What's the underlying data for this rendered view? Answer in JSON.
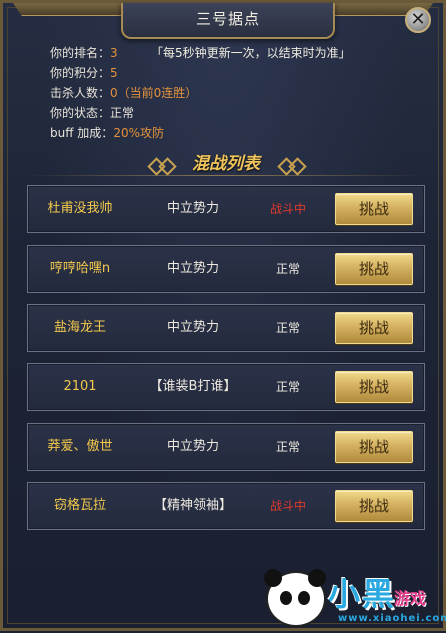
{
  "window": {
    "title": "三号据点",
    "close_label": "✕"
  },
  "stats": {
    "rank_label": "你的排名：",
    "rank_value": "3",
    "refresh_notice": "「每5秒钟更新一次，以结束时为准」",
    "score_label": "你的积分：",
    "score_value": "5",
    "kills_label": "击杀人数：",
    "kills_value": "0（当前0连胜）",
    "status_label": "你的状态：",
    "status_value": "正常",
    "buff_label": "buff 加成：",
    "buff_value": "20%攻防"
  },
  "list": {
    "title": "混战列表",
    "challenge_label": "挑战",
    "rows": [
      {
        "name": "杜甫没我帅",
        "faction": "中立势力",
        "status": "战斗中",
        "fighting": true
      },
      {
        "name": "哼哼哈嘿n",
        "faction": "中立势力",
        "status": "正常",
        "fighting": false
      },
      {
        "name": "盐海龙王",
        "faction": "中立势力",
        "status": "正常",
        "fighting": false
      },
      {
        "name": "2101",
        "faction": "【谁装B打谁】",
        "status": "正常",
        "fighting": false
      },
      {
        "name": "莽爱、傲世",
        "faction": "中立势力",
        "status": "正常",
        "fighting": false
      },
      {
        "name": "窃格瓦拉",
        "faction": "【精神领袖】",
        "status": "战斗中",
        "fighting": true
      }
    ]
  },
  "watermark": {
    "text": "小黑",
    "sub": "游戏",
    "url": "www.xiaohei.com"
  },
  "colors": {
    "accent_orange": "#e4923a",
    "name_gold": "#f2c94c",
    "fighting_red": "#e03a2c",
    "button_gold": "#d4b160"
  }
}
